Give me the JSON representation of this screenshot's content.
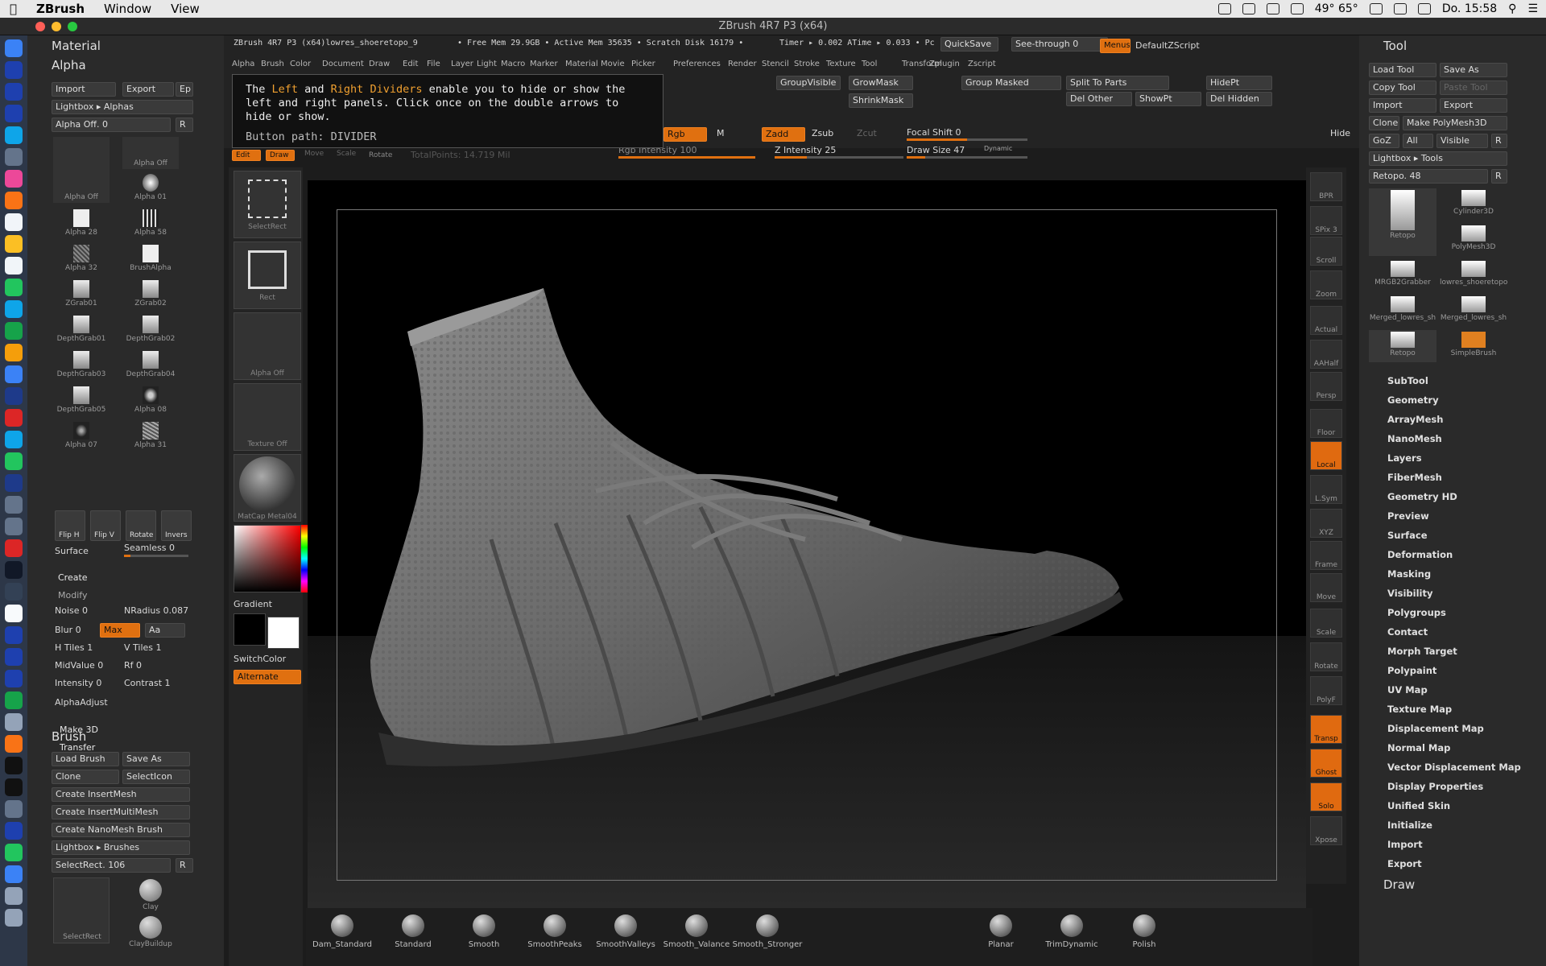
{
  "menubar": {
    "app": "ZBrush",
    "items": [
      "Window",
      "View"
    ],
    "status": {
      "temp": "49° 65°",
      "clock": "Do. 15:58"
    }
  },
  "window": {
    "title": "ZBrush 4R7 P3 (x64)"
  },
  "infobar": {
    "doc": "ZBrush 4R7 P3 (x64)lowres_shoeretopo_9",
    "mem": "• Free Mem 29.9GB • Active Mem 35635 • Scratch Disk 16179 •",
    "timer": "Timer ▸ 0.002 ATime ▸ 0.033 • Pc",
    "quicksave": "QuickSave",
    "seethrough": "See-through 0",
    "menus": "Menus",
    "script": "DefaultZScript"
  },
  "mainmenu": [
    "Alpha",
    "Brush",
    "Color",
    "Document",
    "Draw",
    "Edit",
    "File",
    "Layer",
    "Light",
    "Macro",
    "Marker",
    "Material",
    "Movie",
    "Picker",
    "Preferences",
    "Render",
    "Stencil",
    "Stroke",
    "Texture",
    "Tool",
    "Transform",
    "Zplugin",
    "Zscript"
  ],
  "tooltip": {
    "pre": "The ",
    "left": "Left",
    "mid": " and ",
    "right": "Right Dividers",
    "post": " enable you to hide or show the left and right panels. Click once on the double arrows to hide or show.",
    "path": "Button path: DIVIDER"
  },
  "topbtns": {
    "groupvisible": "GroupVisible",
    "growmask": "GrowMask",
    "shrinkmask": "ShrinkMask",
    "groupmasked": "Group Masked",
    "splitparts": "Split To Parts",
    "delother": "Del Other",
    "showpt": "ShowPt",
    "hidept": "HidePt",
    "delhidden": "Del Hidden",
    "rgb": "Rgb",
    "m": "M",
    "zadd": "Zadd",
    "zsub": "Zsub",
    "zcut": "Zcut",
    "rgbint": "Rgb Intensity 100",
    "zint": "Z Intensity 25",
    "focal": "Focal Shift 0",
    "drawsize": "Draw Size 47",
    "dynamic": "Dynamic",
    "edit": "Edit",
    "draw": "Draw",
    "move": "Move",
    "scale": "Scale",
    "rotate": "Rotate",
    "totalpoints": "TotalPoints: 14.719 Mil",
    "hide": "Hide"
  },
  "left": {
    "material": "Material",
    "alpha": "Alpha",
    "import": "Import",
    "export": "Export",
    "ep": "Ep",
    "lightbox": "Lightbox ▸ Alphas",
    "alphaoff": "Alpha Off. 0",
    "r": "R",
    "thumbs": [
      "Alpha Off",
      "Alpha Off",
      "Alpha 01",
      "Alpha 28",
      "Alpha 58",
      "Alpha 32",
      "BrushAlpha",
      "ZGrab01",
      "ZGrab02",
      "DepthGrab01",
      "DepthGrab02",
      "DepthGrab03",
      "DepthGrab04",
      "DepthGrab05",
      "Alpha 08",
      "Alpha 07",
      "Alpha 31"
    ],
    "flip": [
      "Flip H",
      "Flip V",
      "Rotate",
      "Invers"
    ],
    "surface": "Surface",
    "seamless": "Seamless 0",
    "create": "Create",
    "modify": "Modify",
    "noise": "Noise 0",
    "nradius": "NRadius 0.087",
    "blur": "Blur 0",
    "max": "Max",
    "aa": "Aa",
    "htiles": "H Tiles 1",
    "vtiles": "V Tiles 1",
    "midvalue": "MidValue 0",
    "rf": "Rf 0",
    "intensity": "Intensity 0",
    "contrast": "Contrast 1",
    "alphaadjust": "AlphaAdjust",
    "make3d": "Make 3D",
    "transfer": "Transfer",
    "brush": "Brush",
    "loadbrush": "Load Brush",
    "saveas": "Save As",
    "clone": "Clone",
    "selecticon": "SelectIcon",
    "insertmesh": "Create InsertMesh",
    "insertmulti": "Create InsertMultiMesh",
    "nanomesh": "Create NanoMesh Brush",
    "lbbrushes": "Lightbox ▸ Brushes",
    "selectrect": "SelectRect. 106",
    "bthumbs": [
      "SelectRect",
      "Clay",
      "ClayBuildup"
    ]
  },
  "midtools": {
    "tiles": [
      "SelectRect",
      "Rect",
      "Alpha Off",
      "Texture Off",
      "MatCap Metal04"
    ],
    "gradient": "Gradient",
    "switchcolor": "SwitchColor",
    "alternate": "Alternate"
  },
  "righttools": [
    "BPR",
    "SPix 3",
    "Scroll",
    "Zoom",
    "Actual",
    "AAHalf",
    "Persp",
    "Floor",
    "Local",
    "L.Sym",
    "XYZ",
    "Frame",
    "Move",
    "Scale",
    "Rotate",
    "PolyF",
    "Transp",
    "Ghost",
    "Solo",
    "Xpose"
  ],
  "tool": {
    "title": "Tool",
    "load": "Load Tool",
    "saveas": "Save As",
    "copy": "Copy Tool",
    "paste": "Paste Tool",
    "import": "Import",
    "export": "Export",
    "clone": "Clone",
    "makepoly": "Make PolyMesh3D",
    "goz": "GoZ",
    "all": "All",
    "visible": "Visible",
    "r": "R",
    "lbtools": "Lightbox ▸ Tools",
    "retopo": "Retopo. 48",
    "thumbs": [
      "Retopo",
      "Cylinder3D",
      "PolyMesh3D",
      "MRGB2Grabber",
      "lowres_shoeretopo",
      "Merged_lowres_sh",
      "Merged_lowres_sh",
      "Retopo",
      "SimpleBrush"
    ],
    "menus": [
      "SubTool",
      "Geometry",
      "ArrayMesh",
      "NanoMesh",
      "Layers",
      "FiberMesh",
      "Geometry HD",
      "Preview",
      "Surface",
      "Deformation",
      "Masking",
      "Visibility",
      "Polygroups",
      "Contact",
      "Morph Target",
      "Polypaint",
      "UV Map",
      "Texture Map",
      "Displacement Map",
      "Normal Map",
      "Vector Displacement Map",
      "Display Properties",
      "Unified Skin",
      "Initialize",
      "Import",
      "Export"
    ],
    "draw": "Draw"
  },
  "shelf": [
    "Dam_Standard",
    "Standard",
    "Smooth",
    "SmoothPeaks",
    "SmoothValleys",
    "Smooth_Valance",
    "Smooth_Stronger",
    "Planar",
    "TrimDynamic",
    "Polish"
  ],
  "colors": {
    "accent": "#e07010",
    "bg": "#2a2a2a"
  }
}
